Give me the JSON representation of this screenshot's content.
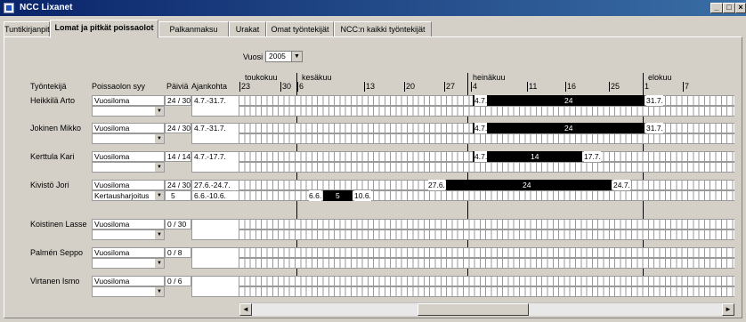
{
  "window": {
    "title": "NCC Lixanet",
    "btn_min": "_",
    "btn_max": "□",
    "btn_close": "×"
  },
  "tabs": [
    {
      "label": "Tuntikirjanpito"
    },
    {
      "label": "Lomat ja pitkät poissaolot"
    },
    {
      "label": "Palkanmaksu"
    },
    {
      "label": "Urakat"
    },
    {
      "label": "Omat työntekijät"
    },
    {
      "label": "NCC:n kaikki työntekijät"
    }
  ],
  "year": {
    "label": "Vuosi",
    "value": "2005"
  },
  "headers": {
    "employee": "Työntekijä",
    "reason": "Poissaolon syy",
    "days": "Päiviä",
    "period": "Ajankohta"
  },
  "months": [
    "toukokuu",
    "kesäkuu",
    "heinäkuu",
    "elokuu"
  ],
  "week_days": [
    "23",
    "30",
    "6",
    "13",
    "20",
    "27",
    "4",
    "11",
    "16",
    "25",
    "1",
    "7"
  ],
  "employees": [
    {
      "name": "Heikkilä Arto",
      "reason1": "Vuosiloma",
      "days1": "24 / 30",
      "period1": "4.7.-31.7.",
      "bar_start": "4.7.",
      "bar_mid": "24",
      "bar_end": "31.7."
    },
    {
      "name": "Jokinen Mikko",
      "reason1": "Vuosiloma",
      "days1": "24 / 30",
      "period1": "4.7.-31.7.",
      "bar_start": "4.7.",
      "bar_mid": "24",
      "bar_end": "31.7."
    },
    {
      "name": "Kerttula Kari",
      "reason1": "Vuosiloma",
      "days1": "14 / 14",
      "period1": "4.7.-17.7.",
      "bar_start": "4.7.",
      "bar_mid": "14",
      "bar_end": "17.7."
    },
    {
      "name": "Kivistö Jori",
      "reason1": "Vuosiloma",
      "days1": "24 / 30",
      "period1": "27.6.-24.7.",
      "bar_start": "27.6.",
      "bar_mid": "24",
      "bar_end": "24.7.",
      "reason2": "Kertausharjoitus",
      "days2": "5",
      "period2": "6.6.-10.6.",
      "bar2_start": "6.6.",
      "bar2_mid": "5",
      "bar2_end": "10.6."
    },
    {
      "name": "Koistinen Lasse",
      "reason1": "Vuosiloma",
      "days1": "0 / 30"
    },
    {
      "name": "Palmén Seppo",
      "reason1": "Vuosiloma",
      "days1": "0 / 8"
    },
    {
      "name": "Virtanen Ismo",
      "reason1": "Vuosiloma",
      "days1": "0 / 6"
    }
  ],
  "scroll": {
    "left": "◄",
    "right": "►"
  }
}
